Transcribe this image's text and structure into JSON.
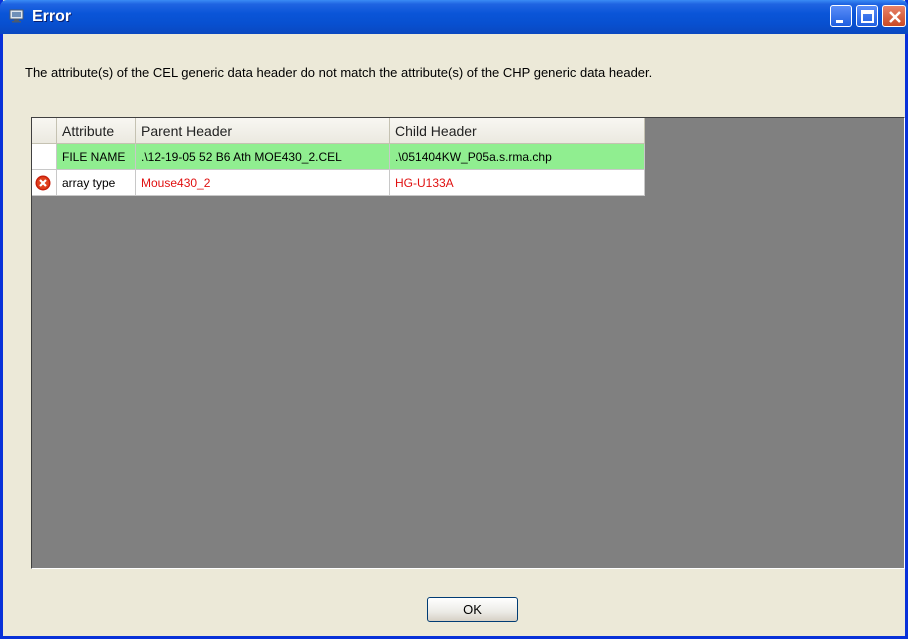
{
  "window": {
    "title": "Error",
    "colors": {
      "titlebar": "#0a55d8",
      "background": "#ece9d8",
      "grid_background": "#808080"
    }
  },
  "message": "The attribute(s) of the CEL generic data header do not match the attribute(s) of the CHP generic data header.",
  "table": {
    "headers": [
      "",
      "Attribute",
      "Parent Header",
      "Child Header"
    ],
    "rows": [
      {
        "status": "match",
        "attribute": "FILE NAME",
        "parent": ".\\12-19-05 52 B6 Ath MOE430_2.CEL",
        "child": ".\\051404KW_P05a.s.rma.chp",
        "row_color": "#90ee90"
      },
      {
        "status": "mismatch",
        "status_icon": "error-icon",
        "attribute": "array type",
        "parent": "Mouse430_2",
        "child": "HG-U133A",
        "text_color": "#e01010"
      }
    ]
  },
  "buttons": {
    "ok_label": "OK"
  }
}
